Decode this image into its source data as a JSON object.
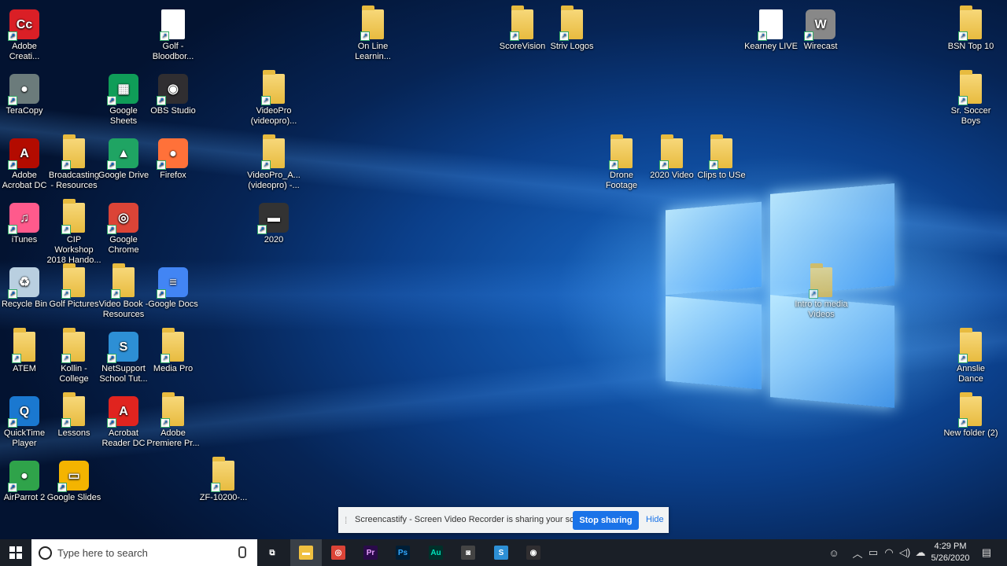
{
  "desktop": {
    "icons": [
      {
        "label": "Adobe Creati...",
        "kind": "app",
        "color": "#da1f26",
        "letter": "Cc"
      },
      {
        "label": "TeraCopy",
        "kind": "app",
        "color": "#6b7b7b",
        "letter": "●"
      },
      {
        "label": "Adobe Acrobat DC",
        "kind": "app",
        "color": "#b30b00",
        "letter": "A"
      },
      {
        "label": "iTunes",
        "kind": "app",
        "color": "#ff5a8c",
        "letter": "♫"
      },
      {
        "label": "Recycle Bin",
        "kind": "app",
        "color": "#b9cfe0",
        "letter": "♻"
      },
      {
        "label": "ATEM",
        "kind": "folder"
      },
      {
        "label": "QuickTime Player",
        "kind": "app",
        "color": "#1a78d0",
        "letter": "Q"
      },
      {
        "label": "AirParrot 2",
        "kind": "app",
        "color": "#2fa34a",
        "letter": "●"
      },
      {
        "label": "Golf - Bloodbor...",
        "kind": "doc"
      },
      {
        "label": "Google Sheets",
        "kind": "app",
        "color": "#0f9d58",
        "letter": "▦"
      },
      {
        "label": "Broadcasting - Resources",
        "kind": "folder"
      },
      {
        "label": "CIP Workshop 2018 Hando...",
        "kind": "folder"
      },
      {
        "label": "Golf Pictures",
        "kind": "folder"
      },
      {
        "label": "Kollin - College",
        "kind": "folder"
      },
      {
        "label": "Lessons",
        "kind": "folder"
      },
      {
        "label": "Google Slides",
        "kind": "app",
        "color": "#f4b400",
        "letter": "▭"
      },
      {
        "label": "OBS Studio",
        "kind": "app",
        "color": "#302e31",
        "letter": "◉"
      },
      {
        "label": "Google Drive",
        "kind": "app",
        "color": "#1fa463",
        "letter": "▲"
      },
      {
        "label": "Google Chrome",
        "kind": "app",
        "color": "#db4437",
        "letter": "◎"
      },
      {
        "label": "Video Book - Resources",
        "kind": "folder"
      },
      {
        "label": "NetSupport School Tut...",
        "kind": "app",
        "color": "#2d8fd5",
        "letter": "S"
      },
      {
        "label": "Acrobat Reader DC",
        "kind": "app",
        "color": "#e0241f",
        "letter": "A"
      },
      {
        "label": "Firefox",
        "kind": "app",
        "color": "#ff7139",
        "letter": "●"
      },
      {
        "label": "Google Docs",
        "kind": "app",
        "color": "#4285f4",
        "letter": "≡"
      },
      {
        "label": "Media Pro",
        "kind": "folder"
      },
      {
        "label": "Adobe Premiere Pr...",
        "kind": "folder"
      },
      {
        "label": "ZF-10200-...",
        "kind": "folder"
      },
      {
        "label": "VideoPro (videopro)...",
        "kind": "folder"
      },
      {
        "label": "VideoPro_A... (videopro) -...",
        "kind": "folder"
      },
      {
        "label": "2020",
        "kind": "app",
        "color": "#333333",
        "letter": "▬"
      },
      {
        "label": "On Line Learnin...",
        "kind": "folder"
      },
      {
        "label": "ScoreVision",
        "kind": "folder"
      },
      {
        "label": "Striv Logos",
        "kind": "folder"
      },
      {
        "label": "Drone Footage",
        "kind": "folder"
      },
      {
        "label": "2020 Video",
        "kind": "folder"
      },
      {
        "label": "Clips to USe",
        "kind": "folder"
      },
      {
        "label": "Kearney LIVE",
        "kind": "doc"
      },
      {
        "label": "Wirecast",
        "kind": "app",
        "color": "#888888",
        "letter": "W"
      },
      {
        "label": "BSN Top 10",
        "kind": "folder"
      },
      {
        "label": "Sr. Soccer Boys",
        "kind": "folder"
      },
      {
        "label": "Intro to media Videos",
        "kind": "folder"
      },
      {
        "label": "Annslie Dance",
        "kind": "folder"
      },
      {
        "label": "New folder (2)",
        "kind": "folder"
      }
    ]
  },
  "notification": {
    "message": "Screencastify - Screen Video Recorder is sharing your screen.",
    "stop_label": "Stop sharing",
    "hide_label": "Hide"
  },
  "taskbar": {
    "search_placeholder": "Type here to search",
    "apps": [
      {
        "name": "task-view",
        "glyph": "⧉",
        "color": "#1a1f27"
      },
      {
        "name": "file-explorer",
        "glyph": "▬",
        "color": "#f0c040"
      },
      {
        "name": "chrome",
        "glyph": "◎",
        "color": "#db4437"
      },
      {
        "name": "premiere",
        "glyph": "Pr",
        "color": "#2a0a4a"
      },
      {
        "name": "photoshop",
        "glyph": "Ps",
        "color": "#001e36"
      },
      {
        "name": "audition",
        "glyph": "Au",
        "color": "#00302a"
      },
      {
        "name": "camera",
        "glyph": "◙",
        "color": "#444444"
      },
      {
        "name": "netsupport",
        "glyph": "S",
        "color": "#2d8fd5"
      },
      {
        "name": "obs",
        "glyph": "◉",
        "color": "#302e31"
      }
    ],
    "time": "4:29 PM",
    "date": "5/26/2020"
  }
}
